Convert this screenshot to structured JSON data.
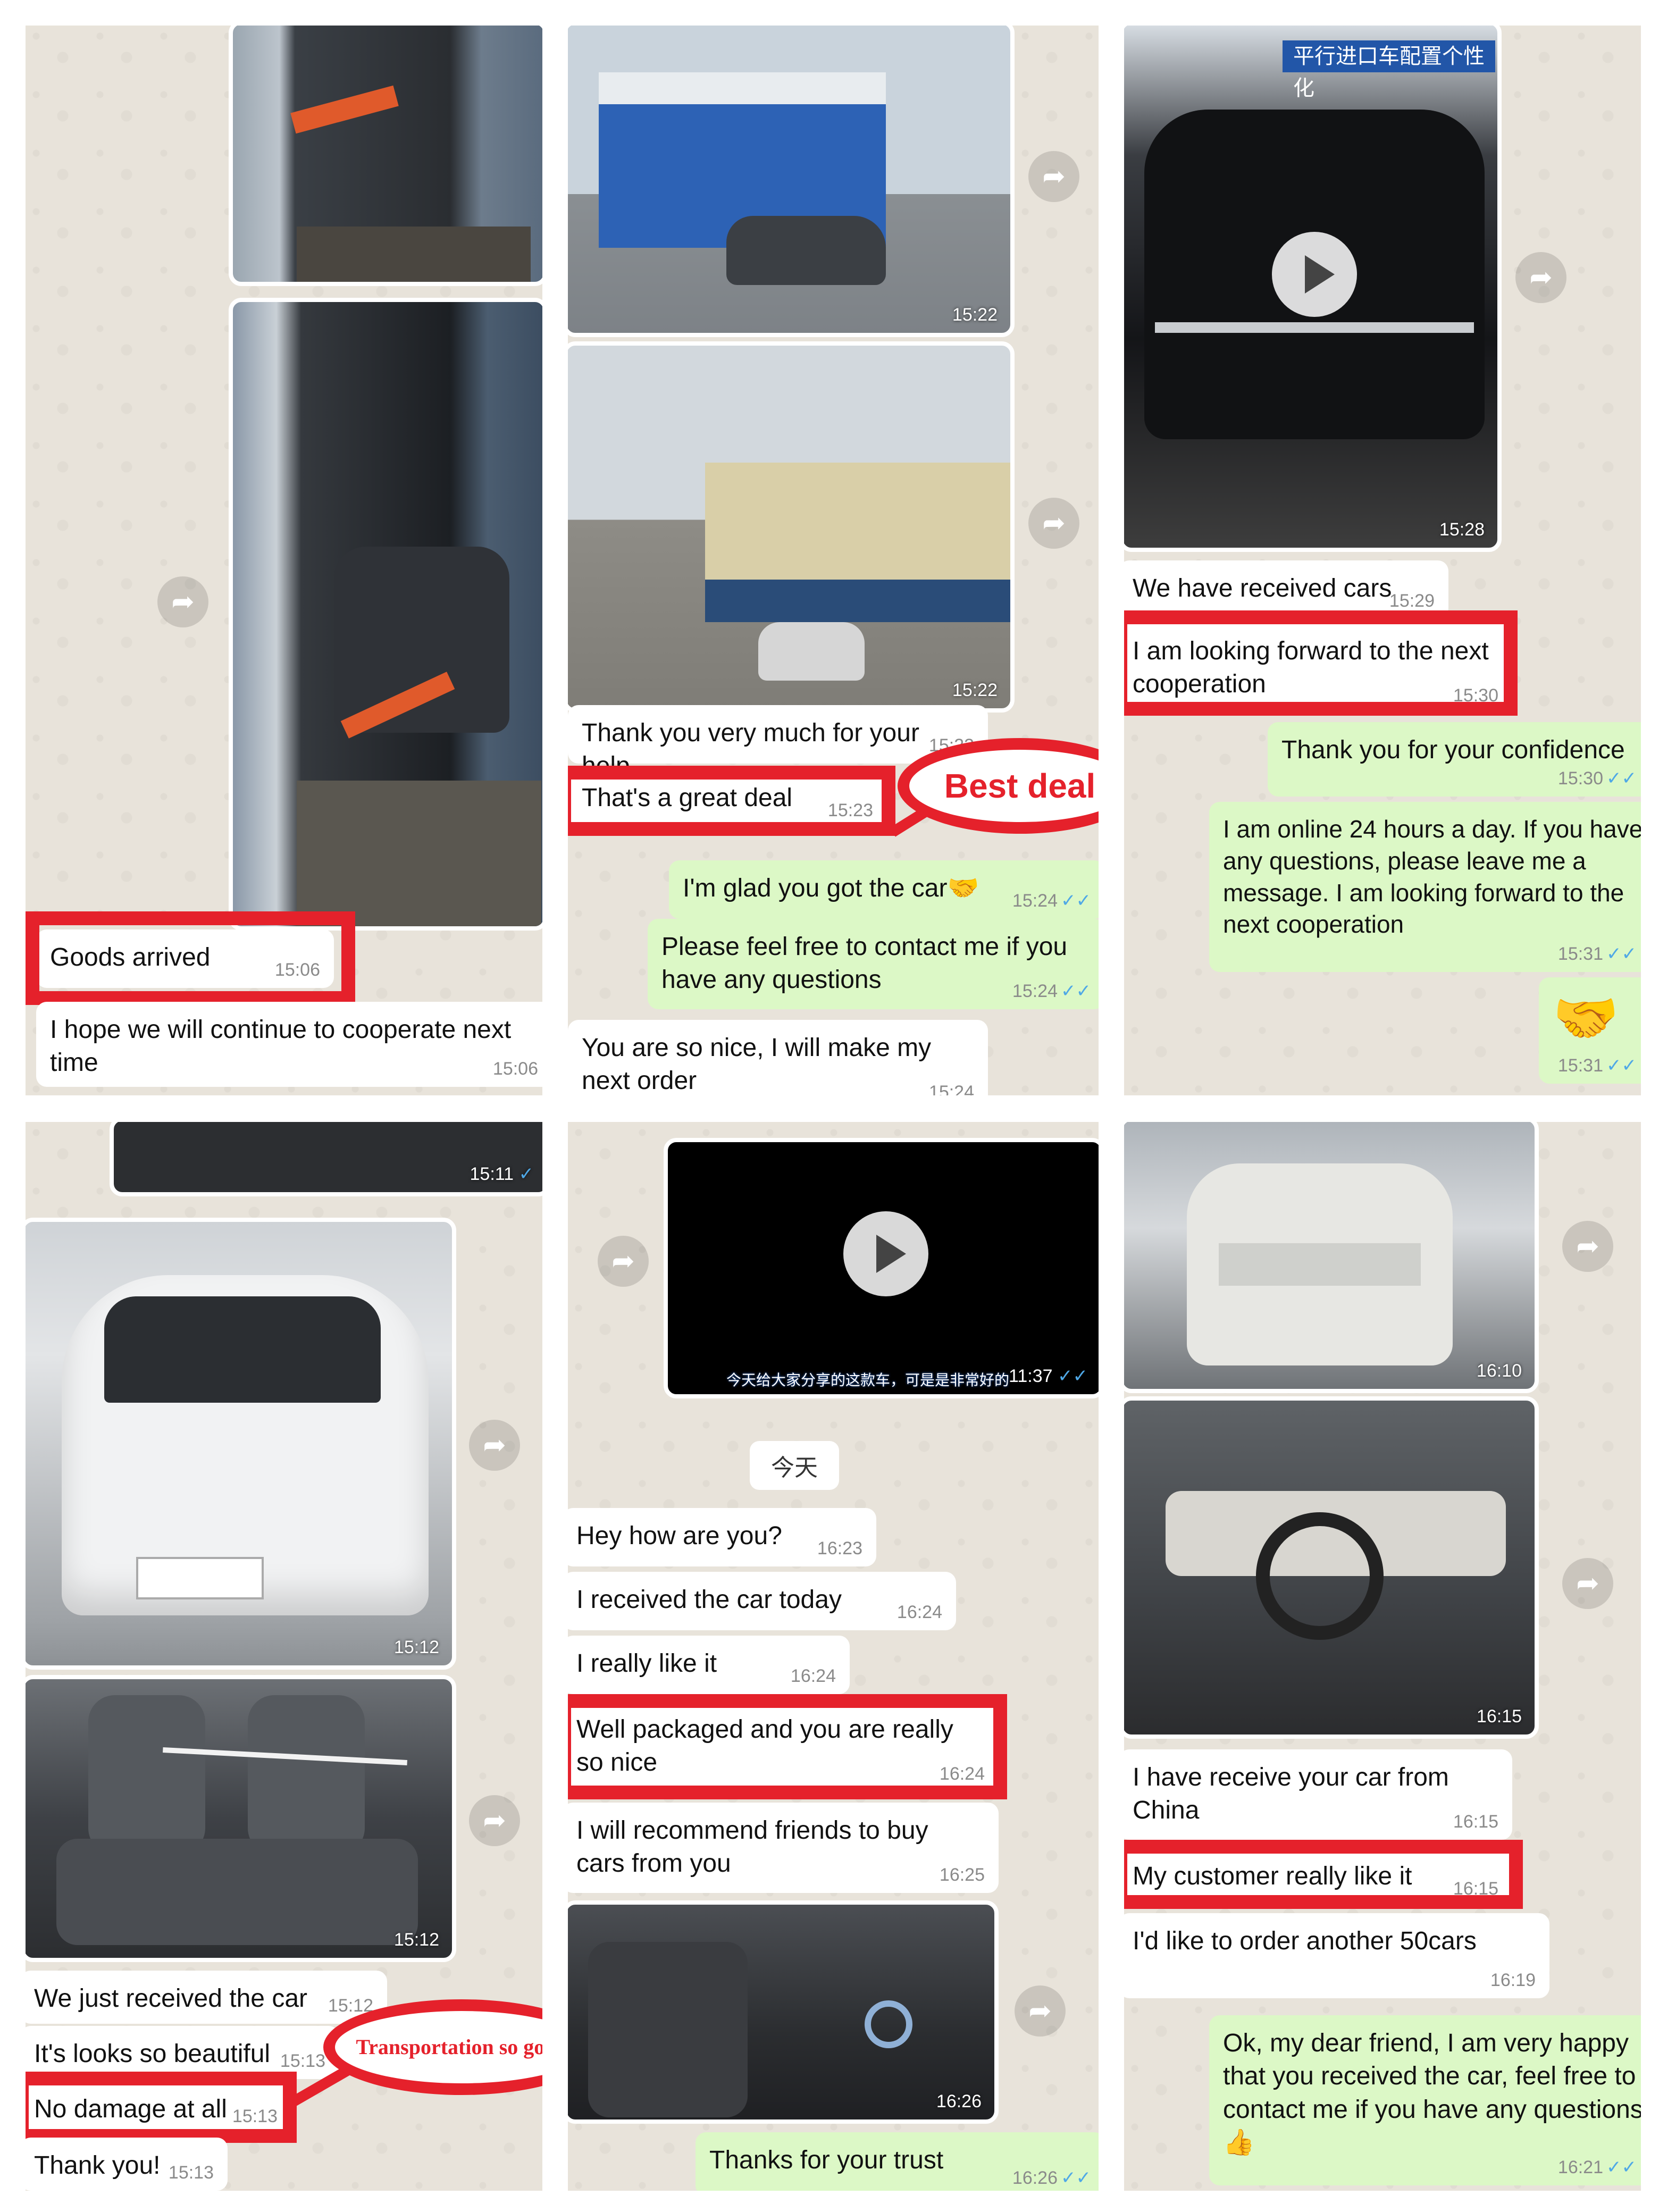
{
  "colors": {
    "incoming": "#ffffff",
    "outgoing": "#dcf8c6",
    "highlight": "#e5212b",
    "timestamp": "#8a8a8a",
    "read_check": "#4fa8e6"
  },
  "icons": {
    "forward": "forward-arrow-icon",
    "play": "play-icon",
    "read": "double-check-icon"
  },
  "p1": {
    "goods_arrived": "Goods arrived",
    "t1": "15:06",
    "hope": "I hope we will continue to cooperate next time",
    "t2": "15:06"
  },
  "p2": {
    "photo1_time": "15:22",
    "photo2_time": "15:22",
    "thank": "Thank you very much for your help",
    "thank_time": "15:23",
    "stamp": "Best deal",
    "great_deal": "That's a great deal",
    "great_deal_time": "15:23",
    "glad": "I'm glad you got the car",
    "glad_emoji": "🤝",
    "glad_time": "15:24",
    "feel_free": "Please feel free to contact me if you have any questions",
    "feel_free_time": "15:24",
    "so_nice": "You are so nice, I will make my next order",
    "so_nice_time": "15:24"
  },
  "p3": {
    "sign": "平行进口车配置个性化",
    "video_time": "15:28",
    "received": "We have received cars",
    "received_time": "15:29",
    "forward": "I am looking forward to the next cooperation",
    "forward_time": "15:30",
    "confidence": "Thank you for your confidence",
    "confidence_time": "15:30",
    "online": "I am online 24 hours a day. If you have any questions, please leave me a message. I am looking forward to the next cooperation",
    "online_time": "15:31",
    "handshake": "🤝",
    "handshake_time": "15:31"
  },
  "p4": {
    "top_time": "15:11",
    "photo1_time": "15:12",
    "photo2_time": "15:12",
    "just_received": "We just received the car",
    "just_received_time": "15:12",
    "beautiful": "It's looks so beautiful",
    "beautiful_time": "15:13",
    "stamp": "Transportation so good",
    "no_damage": "No damage at all",
    "no_damage_time": "15:13",
    "thank_you": "Thank you!",
    "thank_you_time": "15:13"
  },
  "p5": {
    "video_caption": "今天给大家分享的这款车，可是是非常好的",
    "video_time": "11:37",
    "day": "今天",
    "hey": "Hey how are you?",
    "hey_time": "16:23",
    "received": "I received the car today",
    "received_time": "16:24",
    "like": "I really like it",
    "like_time": "16:24",
    "packaged": "Well packaged and you are really so nice",
    "packaged_time": "16:24",
    "recommend": "I will recommend friends to buy cars from you",
    "recommend_time": "16:25",
    "photo_time": "16:26",
    "thanks": "Thanks for your trust",
    "thanks_time": "16:26"
  },
  "p6": {
    "photo1_time": "16:10",
    "photo2_time": "16:15",
    "have_receive": "I have receive your car from China",
    "have_receive_time": "16:15",
    "customer": "My customer really like it",
    "customer_time": "16:15",
    "order": "I'd like to order another 50cars",
    "order_time": "16:19",
    "ok": "Ok, my dear friend, I am very happy that you received the car, feel free to contact me if you have any questions",
    "ok_emoji": "👍",
    "ok_time": "16:21"
  }
}
